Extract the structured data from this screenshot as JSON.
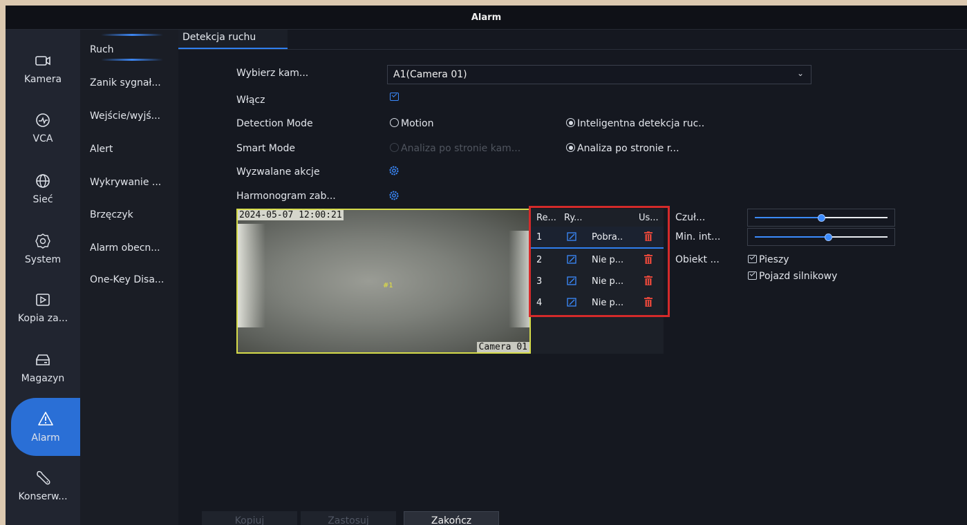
{
  "window": {
    "title": "Alarm"
  },
  "rail": {
    "items": [
      {
        "label": "Kamera",
        "icon": "camera-icon"
      },
      {
        "label": "VCA",
        "icon": "vca-icon"
      },
      {
        "label": "Sieć",
        "icon": "globe-icon"
      },
      {
        "label": "System",
        "icon": "gear-icon"
      },
      {
        "label": "Kopia za...",
        "icon": "play-icon"
      },
      {
        "label": "Magazyn",
        "icon": "storage-icon"
      },
      {
        "label": "Alarm",
        "icon": "warning-icon"
      },
      {
        "label": "Konserw...",
        "icon": "wrench-icon"
      }
    ],
    "active": "Alarm"
  },
  "submenu": {
    "items": [
      "Ruch",
      "Zanik sygnał...",
      "Wejście/wyjś...",
      "Alert",
      "Wykrywanie ...",
      "Brzęczyk",
      "Alarm obecn...",
      "One-Key Disa..."
    ],
    "active": "Ruch"
  },
  "tab": {
    "label": "Detekcja ruchu"
  },
  "form": {
    "camera_label": "Wybierz kam...",
    "camera_value": "A1(Camera 01)",
    "enable_label": "Włącz",
    "enable_checked": true,
    "detection_mode_label": "Detection Mode",
    "detection_opt1": "Motion",
    "detection_opt2": "Inteligentna detekcja ruc..",
    "detection_selected": "Inteligentna detekcja ruc..",
    "smart_mode_label": "Smart Mode",
    "smart_opt1": "Analiza po stronie kam...",
    "smart_opt2": "Analiza po stronie r...",
    "smart_selected": "Analiza po stronie r...",
    "actions_label": "Wyzwalane akcje",
    "schedule_label": "Harmonogram zab..."
  },
  "preview": {
    "timestamp": "2024-05-07 12:00:21",
    "zone": "#1",
    "camera_name": "Camera 01"
  },
  "rules": {
    "headers": {
      "col1": "Re...",
      "col2": "Ry...",
      "col3": "Us..."
    },
    "rows": [
      {
        "id": "1",
        "state": "Pobra.."
      },
      {
        "id": "2",
        "state": "Nie p..."
      },
      {
        "id": "3",
        "state": "Nie p..."
      },
      {
        "id": "4",
        "state": "Nie p..."
      }
    ]
  },
  "settings": {
    "sensitivity_label": "Czuł...",
    "sensitivity_level": 0.5,
    "min_interval_label": "Min. int...",
    "min_interval_level": 0.55,
    "object_label": "Obiekt ...",
    "object_opt1": "Pieszy",
    "object_opt2": "Pojazd silnikowy"
  },
  "buttons": {
    "copy": "Kopiuj",
    "apply": "Zastosuj",
    "finish": "Zakończ"
  },
  "colors": {
    "accent": "#2f7ff0",
    "highlight_box": "#d42a2a",
    "delete": "#e0463a"
  }
}
